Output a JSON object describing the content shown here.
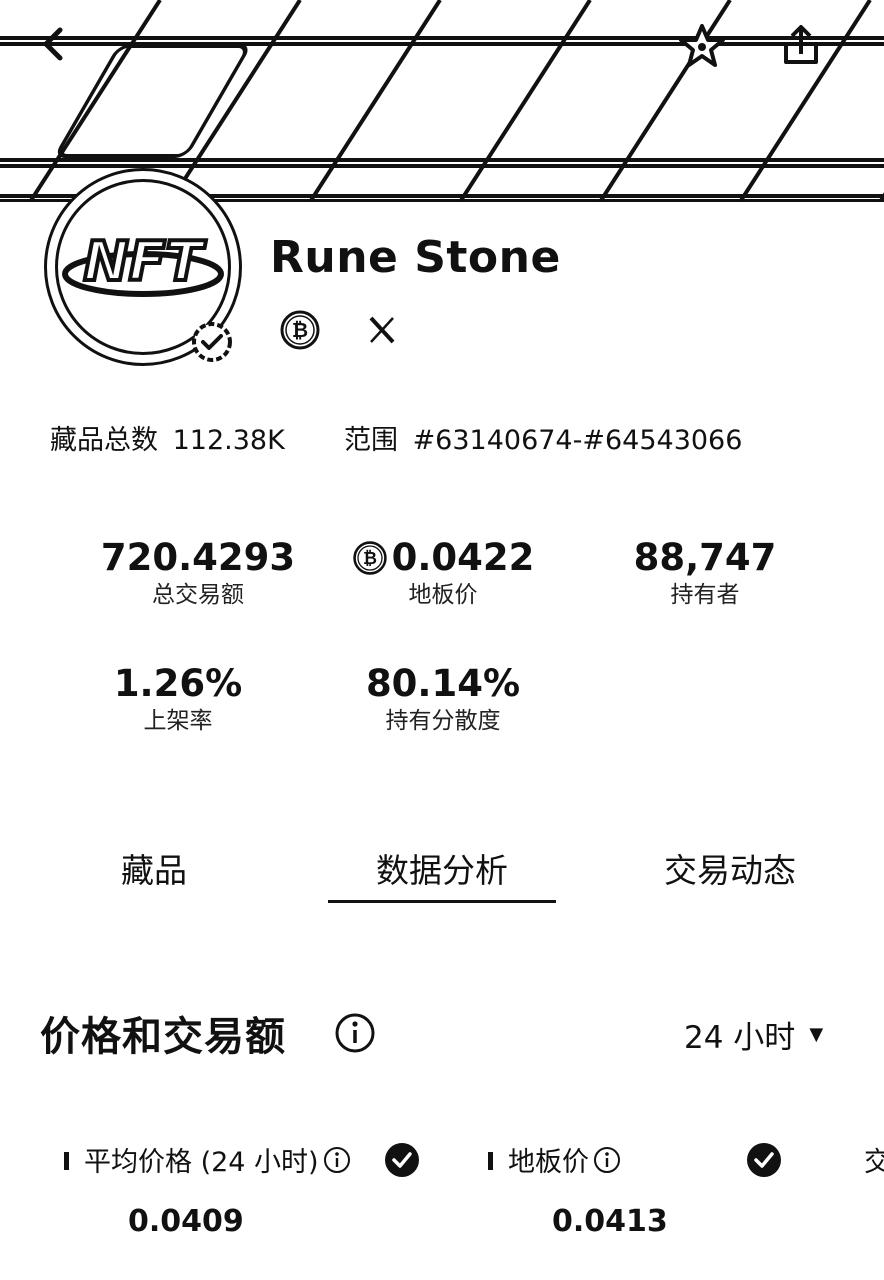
{
  "header": {
    "back_icon": "chevron-left-icon",
    "favorite_icon": "star-icon",
    "share_icon": "share-icon"
  },
  "collection": {
    "avatar_text": "NFT",
    "name": "Rune Stone",
    "verified_icon": "verified-badge-icon",
    "socials": [
      "bitcoin-icon",
      "x-icon"
    ]
  },
  "meta": {
    "total_label": "藏品总数",
    "total_value": "112.38K",
    "range_label": "范围",
    "range_value": "#63140674-#64543066"
  },
  "stats": [
    {
      "value": "720.4293",
      "label": "总交易额"
    },
    {
      "value": "0.0422",
      "label": "地板价",
      "icon": "bitcoin-icon"
    },
    {
      "value": "88,747",
      "label": "持有者"
    },
    {
      "value": "1.26%",
      "label": "上架率"
    },
    {
      "value": "80.14%",
      "label": "持有分散度"
    }
  ],
  "tabs": [
    {
      "label": "藏品",
      "active": false
    },
    {
      "label": "数据分析",
      "active": true
    },
    {
      "label": "交易动态",
      "active": false
    }
  ],
  "section": {
    "title": "价格和交易额",
    "range": "24 小时"
  },
  "metrics": [
    {
      "label": "平均价格 (24 小时)",
      "value": "0.0409"
    },
    {
      "label": "地板价",
      "value": "0.0413"
    },
    {
      "label": "交"
    }
  ],
  "colors": {
    "text": "#111111",
    "background": "#ffffff"
  }
}
